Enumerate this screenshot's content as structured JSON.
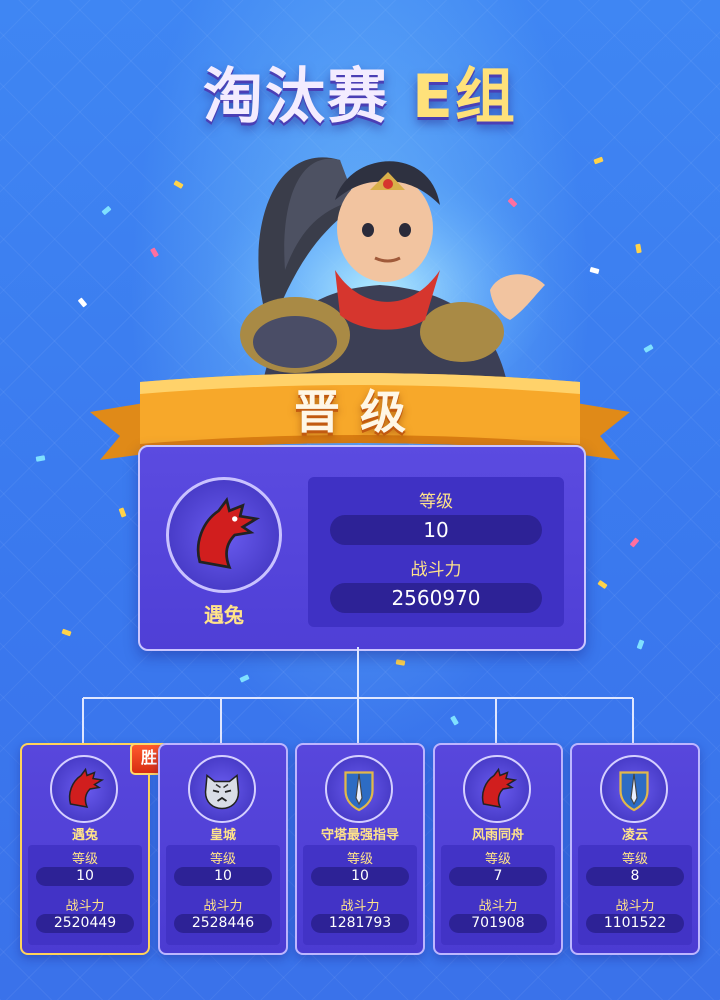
{
  "title": {
    "main": "淘汰赛",
    "group": "E组"
  },
  "banner": {
    "text": "晋级"
  },
  "winner": {
    "name": "遇兔",
    "avatar_icon": "red-dragon-icon",
    "level_label": "等级",
    "level": "10",
    "power_label": "战斗力",
    "power": "2560970"
  },
  "win_badge": "胜",
  "players": [
    {
      "name": "遇兔",
      "avatar_icon": "red-dragon-icon",
      "level_label": "等级",
      "level": "10",
      "power_label": "战斗力",
      "power": "2520449"
    },
    {
      "name": "皇城",
      "avatar_icon": "tiger-icon",
      "level_label": "等级",
      "level": "10",
      "power_label": "战斗力",
      "power": "2528446"
    },
    {
      "name": "守塔最强指导",
      "avatar_icon": "sword-shield-icon",
      "level_label": "等级",
      "level": "10",
      "power_label": "战斗力",
      "power": "1281793"
    },
    {
      "name": "风雨同舟",
      "avatar_icon": "red-dragon-icon",
      "level_label": "等级",
      "level": "7",
      "power_label": "战斗力",
      "power": "701908"
    },
    {
      "name": "凌云",
      "avatar_icon": "sword-shield-icon",
      "level_label": "等级",
      "level": "8",
      "power_label": "战斗力",
      "power": "1101522"
    }
  ],
  "colors": {
    "background": "#3b7cf0",
    "card": "#4f3fd6",
    "accent_text": "#ffe38a",
    "banner": "#f5a623"
  }
}
